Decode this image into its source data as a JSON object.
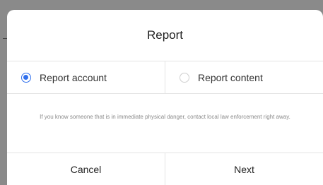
{
  "dialog": {
    "title": "Report",
    "options": [
      {
        "label": "Report account",
        "selected": true
      },
      {
        "label": "Report content",
        "selected": false
      }
    ],
    "notice": "If you know someone that is in immediate physical danger, contact local law enforcement right away.",
    "cancel_label": "Cancel",
    "next_label": "Next"
  },
  "colors": {
    "accent": "#2f6fed",
    "backdrop": "#8a8a8a"
  }
}
